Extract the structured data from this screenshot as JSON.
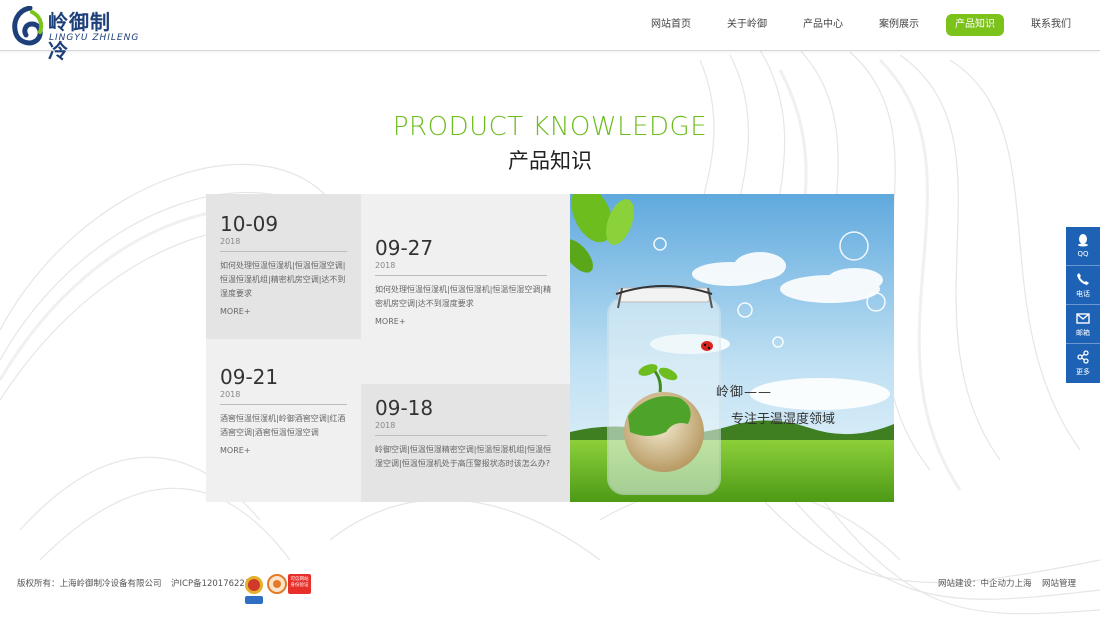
{
  "header": {
    "brand_cn": "岭御制冷",
    "brand_en": "LINGYU ZHILENG",
    "nav": [
      {
        "label": "网站首页",
        "active": false
      },
      {
        "label": "关于岭御",
        "active": false
      },
      {
        "label": "产品中心",
        "active": false
      },
      {
        "label": "案例展示",
        "active": false
      },
      {
        "label": "产品知识",
        "active": true
      },
      {
        "label": "联系我们",
        "active": false
      }
    ]
  },
  "section": {
    "title_en": "PRODUCT KNOWLEDGE",
    "title_cn": "产品知识"
  },
  "articles": [
    {
      "date": "10-09",
      "year": "2018",
      "desc": "如何处理恒温恒湿机|恒温恒湿空调|恒温恒湿机组|精密机房空调|达不到湿度要求",
      "more": "MORE+"
    },
    {
      "date": "09-27",
      "year": "2018",
      "desc": "如何处理恒温恒湿机|恒温恒湿机|恒温恒湿空调|精密机房空调|达不到湿度要求",
      "more": "MORE+"
    },
    {
      "date": "09-21",
      "year": "2018",
      "desc": "酒窖恒温恒湿机|岭御酒窖空调|红酒酒窖空调|酒窖恒温恒湿空调",
      "more": "MORE+"
    },
    {
      "date": "09-18",
      "year": "2018",
      "desc": "岭御空调|恒温恒湿精密空调|恒温恒湿机组|恒温恒湿空调|恒温恒湿机处于高压警报状态时该怎么办?",
      "more": ""
    }
  ],
  "photo": {
    "caption_line1": "岭御——",
    "caption_line2": "专注于温湿度领域"
  },
  "sidebar": [
    {
      "label": "QQ",
      "icon": "qq-icon"
    },
    {
      "label": "电话",
      "icon": "phone-icon"
    },
    {
      "label": "邮箱",
      "icon": "mail-icon"
    },
    {
      "label": "更多",
      "icon": "share-icon"
    }
  ],
  "footer": {
    "copyright": "版权所有：上海岭御制冷设备有限公司",
    "icp": "沪ICP备12017622号",
    "badge3_text": "可信网站 身份验证",
    "build": "网站建设：中企动力上海",
    "admin": "网站管理"
  },
  "colors": {
    "accent_green": "#7bc21a",
    "brand_blue": "#1d3f7a",
    "sidebar_blue": "#1d62b4"
  }
}
